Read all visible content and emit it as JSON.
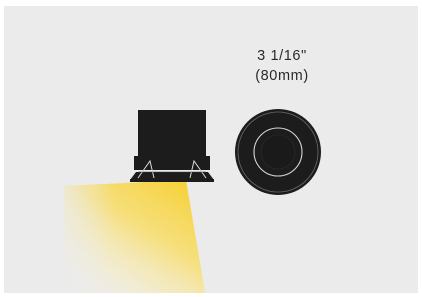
{
  "dimension": {
    "imperial": "3 1/16\"",
    "metric": "(80mm)"
  },
  "colors": {
    "background": "#ebebeb",
    "fixture": "#1c1c1c",
    "light_beam": "#f7d54a",
    "text": "#2a2a2a"
  },
  "icons": {
    "side_view": "downlight-side-view",
    "front_view": "downlight-front-view",
    "light": "light-beam"
  }
}
